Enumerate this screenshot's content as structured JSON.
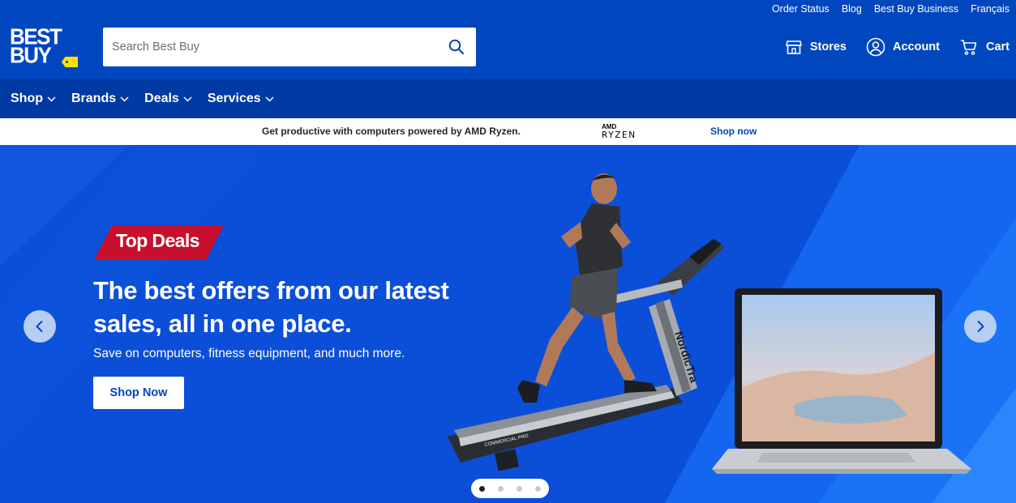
{
  "utility_nav": [
    "Order Status",
    "Blog",
    "Best Buy Business",
    "Français"
  ],
  "logo": {
    "line1": "BEST",
    "line2": "BUY"
  },
  "search": {
    "placeholder": "Search Best Buy"
  },
  "header_links": {
    "stores": "Stores",
    "account": "Account",
    "cart": "Cart"
  },
  "nav": [
    "Shop",
    "Brands",
    "Deals",
    "Services"
  ],
  "promo": {
    "text": "Get productive with computers powered by AMD Ryzen.",
    "amd_top": "AMD",
    "amd_bottom": "RYZEN",
    "link": "Shop now"
  },
  "hero": {
    "badge": "Top Deals",
    "headline": "The best offers from our latest sales, all in one place.",
    "subline": "Save on computers, fitness equipment, and much more.",
    "cta": "Shop Now",
    "treadmill_brand": "NordicTrack",
    "treadmill_model": "COMMERCIAL PRO",
    "slides_total": 4,
    "slide_active": 1
  },
  "colors": {
    "brand_blue": "#0046be",
    "nav_blue": "#003aa3",
    "yellow_tag": "#ffe000",
    "badge_red": "#c8102e"
  },
  "icons": [
    "search-icon",
    "store-icon",
    "account-icon",
    "cart-icon",
    "chevron-down-icon",
    "chevron-left-icon",
    "chevron-right-icon"
  ]
}
